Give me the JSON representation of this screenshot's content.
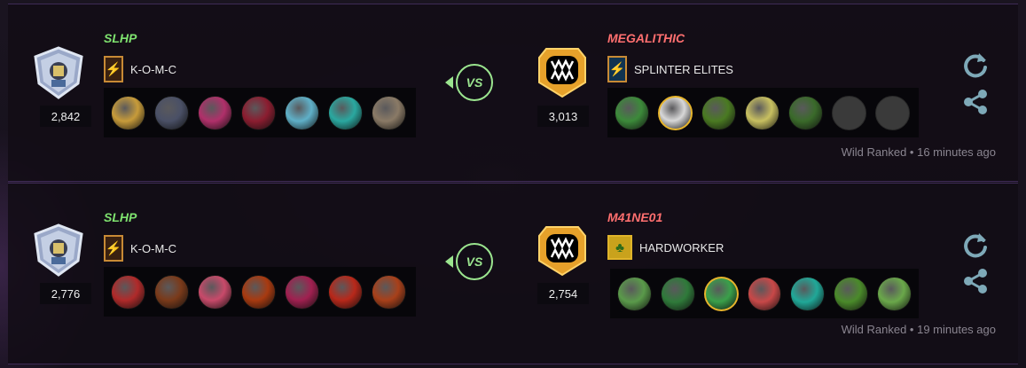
{
  "battles": [
    {
      "player": {
        "name": "SLHP",
        "guild": "K-O-M-C",
        "rating": "2,842",
        "cards": [
          "#c79b3a",
          "#4a5066",
          "#b0306a",
          "#8b1d30",
          "#5fb0c8",
          "#2aa8a0",
          "#8a7a66"
        ]
      },
      "vs_label": "VS",
      "opponent": {
        "name": "MEGALITHIC",
        "guild": "SPLINTER ELITES",
        "rating": "3,013",
        "cards": [
          "#3c8a3a",
          "#d8d8d8",
          "#4a7a22",
          "#c8c060",
          "#3a6a2a",
          "empty",
          "empty"
        ]
      },
      "meta": {
        "mode": "Wild Ranked",
        "separator": " • ",
        "time": "16 minutes ago"
      }
    },
    {
      "player": {
        "name": "SLHP",
        "guild": "K-O-M-C",
        "rating": "2,776",
        "cards": [
          "#b02a2a",
          "#7a3a1a",
          "#c84a6a",
          "#a83a10",
          "#a02050",
          "#b8281a",
          "#a8401a"
        ]
      },
      "vs_label": "VS",
      "opponent": {
        "name": "M41NE01",
        "guild": "HARDWORKER",
        "rating": "2,754",
        "cards": [
          "#5a9a4a",
          "#2f7a3a",
          "#3aa04a",
          "#c84848",
          "#20a898",
          "#4a8a2a",
          "#6aa84a"
        ]
      },
      "meta": {
        "mode": "Wild Ranked",
        "separator": " • ",
        "time": "19 minutes ago"
      }
    }
  ],
  "icons": {
    "guild_player": "lightning-icon",
    "guild_opp1": "lightning-icon",
    "guild_opp2": "tree-icon",
    "replay": "replay-icon",
    "share": "share-icon",
    "player_rank": "shield-rank-icon",
    "opponent_rank": "fanged-mouth-rank-icon"
  },
  "colors": {
    "winner_name": "#7fe36f",
    "loser_name": "#ff6f6f",
    "vs": "#9be58f",
    "icon": "#7ea9b8",
    "meta_text": "#8a8590"
  }
}
